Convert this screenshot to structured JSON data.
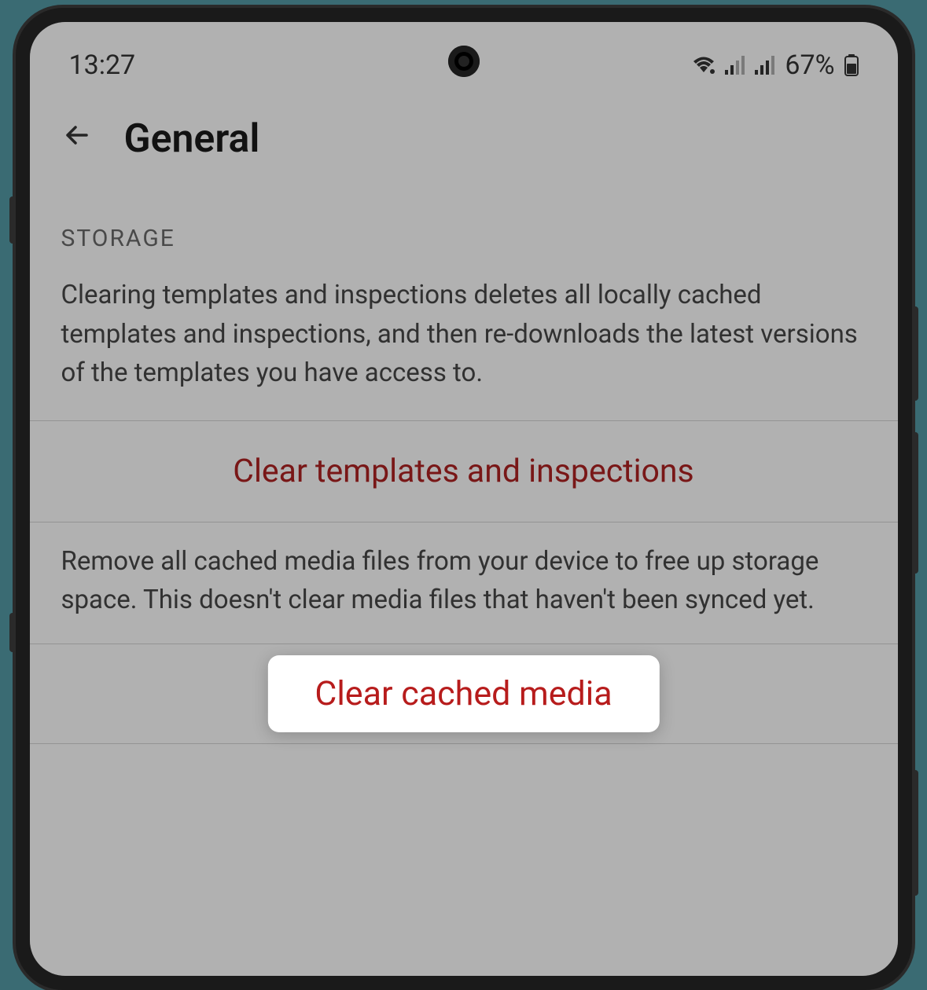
{
  "statusBar": {
    "time": "13:27",
    "batteryPercent": "67%"
  },
  "header": {
    "title": "General"
  },
  "storage": {
    "sectionLabel": "STORAGE",
    "clearTemplatesDescription": "Clearing templates and inspections deletes all locally cached templates and inspections, and then re-downloads the latest versions of the templates you have access to.",
    "clearTemplatesButton": "Clear templates and inspections",
    "clearMediaDescription": "Remove all cached media files from your device to free up storage space. This doesn't clear media files that haven't been synced yet.",
    "clearMediaButton": "Clear cached media"
  }
}
